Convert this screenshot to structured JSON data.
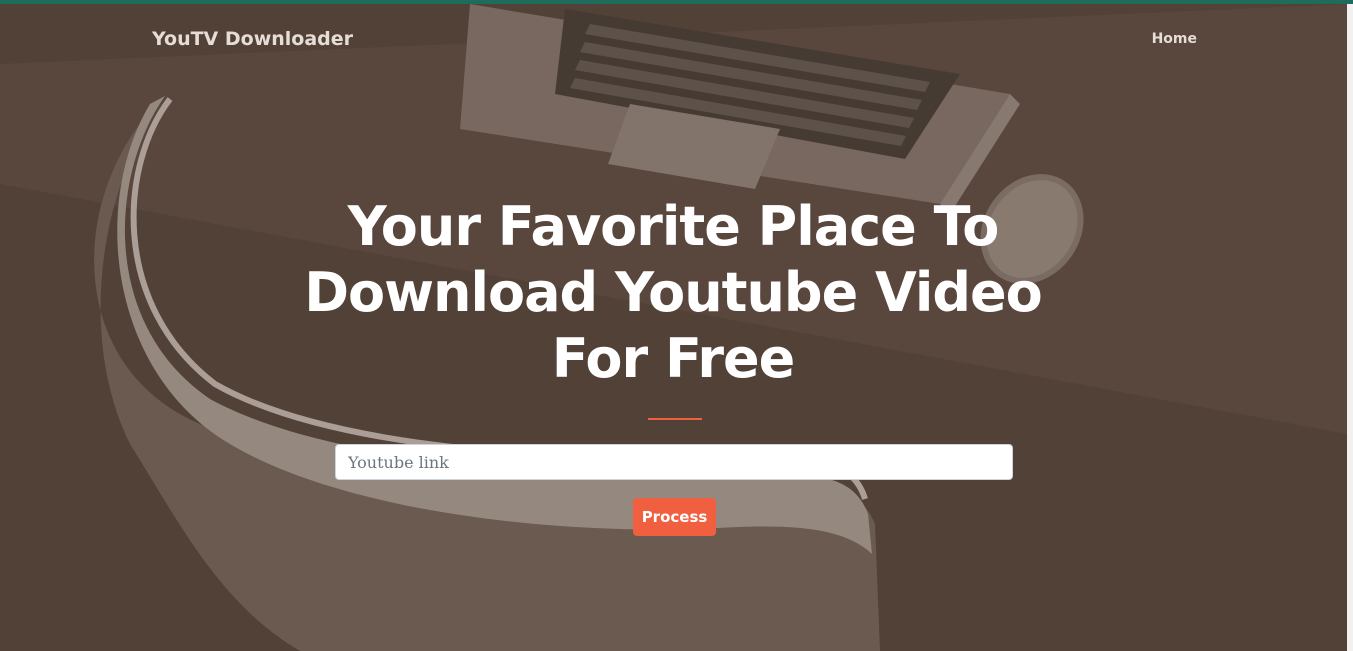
{
  "navbar": {
    "brand": "YouTV Downloader",
    "home_label": "Home"
  },
  "hero": {
    "headline": "Your Favorite Place To Download Youtube Video For Free",
    "input_placeholder": "Youtube link",
    "process_label": "Process"
  },
  "colors": {
    "accent": "#f05f40",
    "top_bar": "#1f6b5c"
  }
}
